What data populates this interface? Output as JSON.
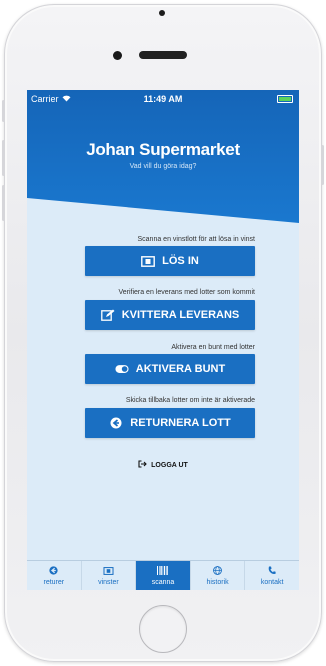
{
  "status_bar": {
    "carrier": "Carrier",
    "time": "11:49 AM"
  },
  "header": {
    "title": "Johan Supermarket",
    "subtitle": "Vad vill du göra idag?"
  },
  "actions": [
    {
      "caption": "Scanna en vinstlott för att lösa in vinst",
      "label": "LÖS IN",
      "icon": "ticket-icon"
    },
    {
      "caption": "Verifiera en leverans med lotter som kommit",
      "label": "KVITTERA LEVERANS",
      "icon": "edit-icon"
    },
    {
      "caption": "Aktivera en bunt med lotter",
      "label": "AKTIVERA BUNT",
      "icon": "toggle-icon"
    },
    {
      "caption": "Skicka tillbaka lotter om inte är aktiverade",
      "label": "RETURNERA LOTT",
      "icon": "return-icon"
    }
  ],
  "logout": {
    "label": "LOGGA UT",
    "icon": "sign-out-icon"
  },
  "tabs": [
    {
      "label": "returer",
      "icon": "return-icon",
      "active": false
    },
    {
      "label": "vinster",
      "icon": "ticket-icon",
      "active": false
    },
    {
      "label": "scanna",
      "icon": "barcode-icon",
      "active": true
    },
    {
      "label": "historik",
      "icon": "globe-icon",
      "active": false
    },
    {
      "label": "kontakt",
      "icon": "phone-icon",
      "active": false
    }
  ],
  "colors": {
    "primary": "#1a6fc2",
    "hero_top": "#1a6fc2",
    "background": "#dcebf8"
  }
}
